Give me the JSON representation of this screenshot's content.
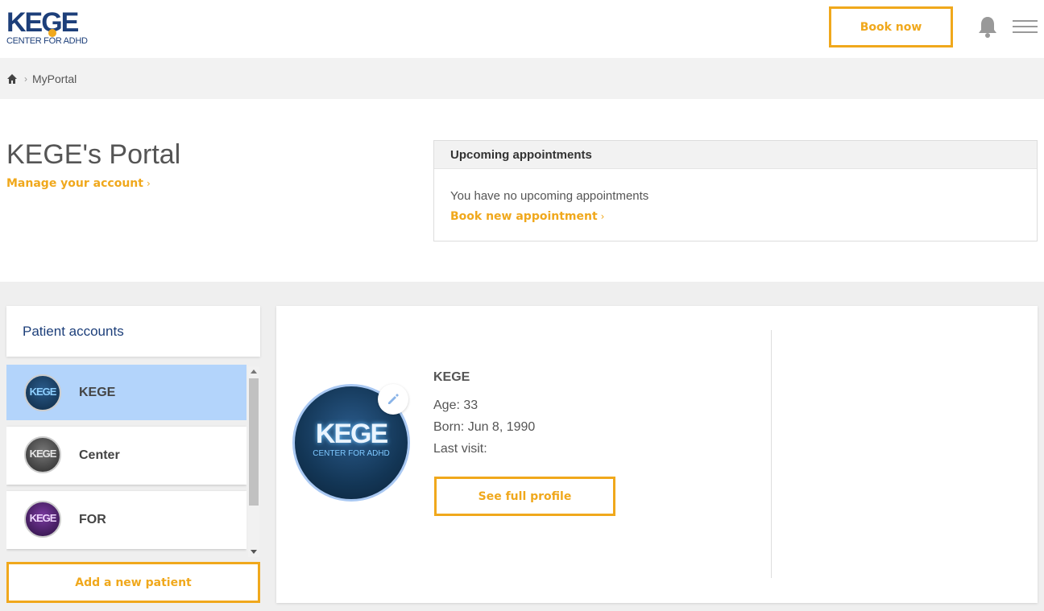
{
  "header": {
    "logo_main": "KEGE",
    "logo_sub": "CENTER FOR ADHD",
    "book_now": "Book now",
    "bell_icon": "bell-icon",
    "menu_icon": "hamburger-menu-icon",
    "accent_color": "#f0a81c",
    "brand_color": "#1d3f7a"
  },
  "breadcrumb": {
    "home_icon": "home-icon",
    "separator": "›",
    "current": "MyPortal"
  },
  "portal": {
    "title": "KEGE's Portal",
    "manage_link": "Manage your account",
    "chevron": "›"
  },
  "appointments": {
    "heading": "Upcoming appointments",
    "empty_text": "You have no upcoming appointments",
    "book_link": "Book new appointment",
    "chevron": "›"
  },
  "patients": {
    "heading": "Patient accounts",
    "items": [
      {
        "name": "KEGE",
        "avatar_text": "KEGE",
        "selected": true
      },
      {
        "name": "Center",
        "avatar_text": "KEGE",
        "selected": false
      },
      {
        "name": "FOR",
        "avatar_text": "KEGE",
        "selected": false
      }
    ],
    "add_button": "Add a new patient"
  },
  "profile": {
    "name": "KEGE",
    "avatar_text": "KEGE",
    "avatar_sub": "CENTER FOR ADHD",
    "age": "Age: 33",
    "born": "Born: Jun 8, 1990",
    "last_visit": "Last visit:",
    "full_profile_button": "See full profile",
    "edit_icon": "pencil-icon"
  }
}
